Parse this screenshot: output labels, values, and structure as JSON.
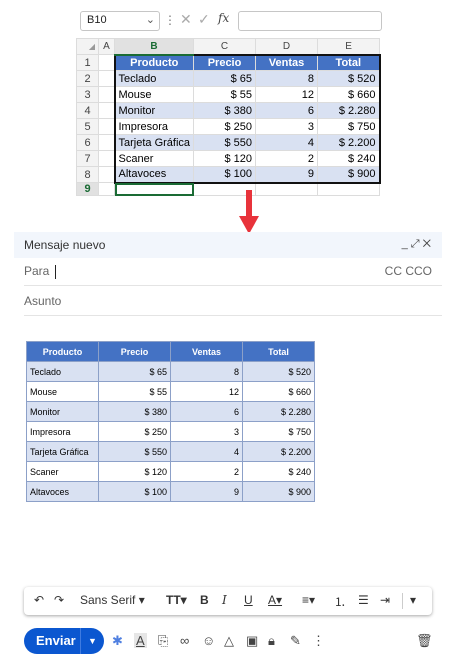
{
  "excel": {
    "namebox": "B10",
    "fx": "fx",
    "columns": [
      "A",
      "B",
      "C",
      "D",
      "E"
    ],
    "rows": [
      "1",
      "2",
      "3",
      "4",
      "5",
      "6",
      "7",
      "8",
      "9"
    ],
    "header": [
      "Producto",
      "Precio",
      "Ventas",
      "Total"
    ],
    "data": [
      [
        "Teclado",
        "$ 65",
        "8",
        "$ 520"
      ],
      [
        "Mouse",
        "$ 55",
        "12",
        "$ 660"
      ],
      [
        "Monitor",
        "$ 380",
        "6",
        "$ 2.280"
      ],
      [
        "Impresora",
        "$ 250",
        "3",
        "$ 750"
      ],
      [
        "Tarjeta Gráfica",
        "$ 550",
        "4",
        "$ 2.200"
      ],
      [
        "Scaner",
        "$ 120",
        "2",
        "$ 240"
      ],
      [
        "Altavoces",
        "$ 100",
        "9",
        "$ 900"
      ]
    ]
  },
  "compose": {
    "title": "Mensaje nuevo",
    "to_label": "Para",
    "cc_label": "CC CCO",
    "subject_label": "Asunto",
    "font_name": "Sans Serif",
    "send_label": "Enviar",
    "table_header": [
      "Producto",
      "Precio",
      "Ventas",
      "Total"
    ],
    "table_data": [
      [
        "Teclado",
        "$ 65",
        "8",
        "$ 520"
      ],
      [
        "Mouse",
        "$ 55",
        "12",
        "$ 660"
      ],
      [
        "Monitor",
        "$ 380",
        "6",
        "$ 2.280"
      ],
      [
        "Impresora",
        "$ 250",
        "3",
        "$ 750"
      ],
      [
        "Tarjeta Gráfica",
        "$ 550",
        "4",
        "$ 2.200"
      ],
      [
        "Scaner",
        "$ 120",
        "2",
        "$ 240"
      ],
      [
        "Altavoces",
        "$ 100",
        "9",
        "$ 900"
      ]
    ]
  },
  "colors": {
    "header_blue": "#4472c4",
    "band_blue": "#d9e1f2",
    "send_blue": "#0b57d0",
    "arrow_red": "#e8333b"
  }
}
